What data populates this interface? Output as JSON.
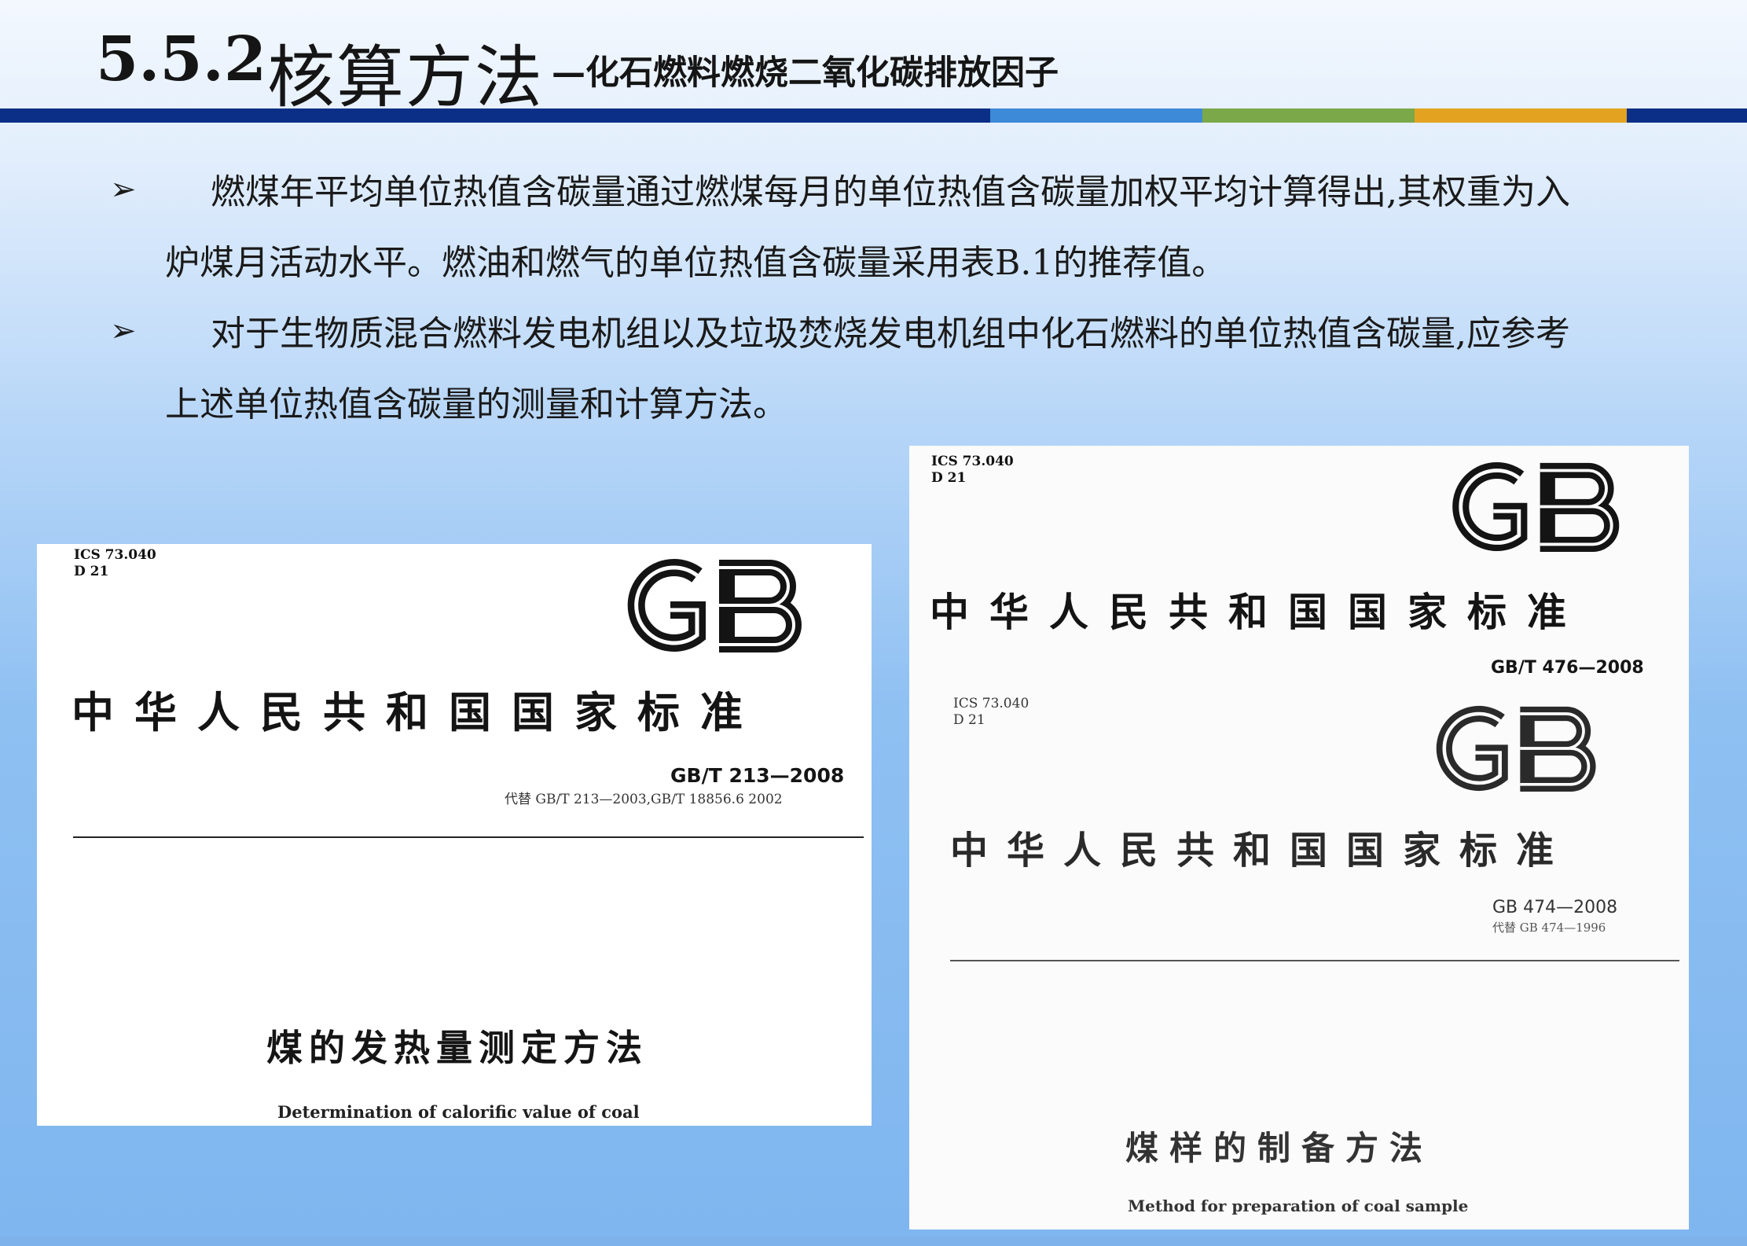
{
  "header": {
    "section_number": "5.5.2",
    "title": "核算方法",
    "subtitle": "—化石燃料燃烧二氧化碳排放因子"
  },
  "bullets": [
    {
      "icon": "arrow-bullet-icon",
      "text": "燃煤年平均单位热值含碳量通过燃煤每月的单位热值含碳量加权平均计算得出,其权重为入炉煤月活动水平。燃油和燃气的单位热值含碳量采用表B.1的推荐值。"
    },
    {
      "icon": "arrow-bullet-icon",
      "text": "对于生物质混合燃料发电机组以及垃圾焚烧发电机组中化石燃料的单位热值含碳量,应参考上述单位热值含碳量的测量和计算方法。"
    }
  ],
  "documents": {
    "left": {
      "ics": "ICS 73.040",
      "ccs": "D 21",
      "logo_text": "GB",
      "standard_title": "中华人民共和国国家标准",
      "standard_number": "GB/T 213—2008",
      "replaces": "代替 GB/T 213—2003,GB/T 18856.6  2002",
      "cn_name": "煤的发热量测定方法",
      "en_name": "Determination of calorific value of coal"
    },
    "right_top": {
      "ics": "ICS 73.040",
      "ccs": "D 21",
      "logo_text": "GB",
      "standard_title": "中华人民共和国国家标准",
      "standard_number": "GB/T 476—2008"
    },
    "right_bottom": {
      "ics": "ICS 73.040",
      "ccs": "D 21",
      "logo_text": "GB",
      "standard_title": "中华人民共和国国家标准",
      "standard_number": "GB 474—2008",
      "replaces": "代替 GB 474—1996",
      "cn_name": "煤样的制备方法",
      "en_name": "Method for preparation of coal sample"
    }
  },
  "colors": {
    "band_navy": "#0b2f86",
    "band_blue": "#3d8ad8",
    "band_green": "#7ba94a",
    "band_orange": "#e3a321"
  }
}
